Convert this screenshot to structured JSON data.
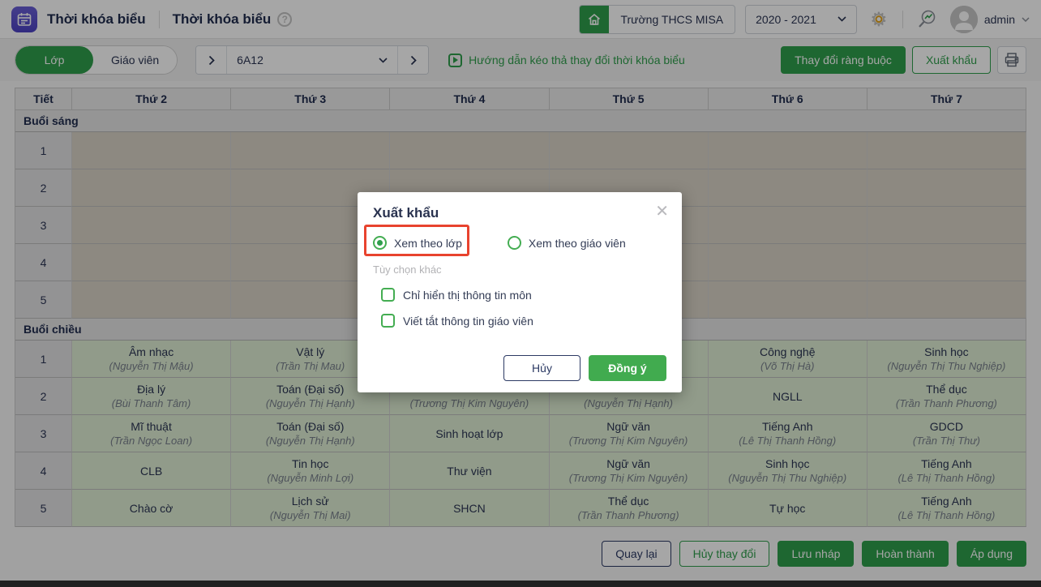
{
  "colors": {
    "brand_green": "#2f9e4c",
    "modal_green": "#41ab4f",
    "annotation_red": "#e8432e",
    "navy_text": "#2b3553",
    "app_icon_purple": "#5b53c8",
    "filled_cell": "#dfeed4",
    "empty_cell": "#d9d3c7"
  },
  "header": {
    "app_title": "Thời khóa biểu",
    "page_title": "Thời khóa biểu",
    "school_name": "Trường THCS MISA",
    "school_year": "2020 - 2021",
    "user_name": "admin"
  },
  "toolbar": {
    "tab_class": "Lớp",
    "tab_teacher": "Giáo viên",
    "selected_class": "6A12",
    "guide_link": "Hướng dẫn kéo thả thay đổi thời khóa biểu",
    "change_constraints_button": "Thay đổi ràng buộc",
    "export_button": "Xuất khẩu"
  },
  "table": {
    "headers": [
      "Tiết",
      "Thứ 2",
      "Thứ 3",
      "Thứ 4",
      "Thứ 5",
      "Thứ 6",
      "Thứ 7"
    ],
    "morning_label": "Buổi sáng",
    "afternoon_label": "Buổi chiều",
    "morning_periods": [
      "1",
      "2",
      "3",
      "4",
      "5"
    ],
    "afternoon_rows": [
      {
        "period": "1",
        "cells": [
          {
            "s": "Âm nhạc",
            "t": "(Nguyễn Thị Mậu)"
          },
          {
            "s": "Vật lý",
            "t": "(Trần Thị Mau)"
          },
          {
            "s": "",
            "t": ""
          },
          {
            "s": "",
            "t": ""
          },
          {
            "s": "Công nghệ",
            "t": "(Võ Thị Hà)"
          },
          {
            "s": "Sinh học",
            "t": "(Nguyễn Thị Thu Nghiệp)"
          }
        ]
      },
      {
        "period": "2",
        "cells": [
          {
            "s": "Địa lý",
            "t": "(Bùi Thanh Tâm)"
          },
          {
            "s": "Toán (Đại số)",
            "t": "(Nguyễn Thị Hạnh)"
          },
          {
            "s": "",
            "t": "(Trương Thị Kim Nguyên)"
          },
          {
            "s": "",
            "t": "(Nguyễn Thị Hạnh)"
          },
          {
            "s": "NGLL",
            "t": ""
          },
          {
            "s": "Thể dục",
            "t": "(Trần Thanh Phương)"
          }
        ]
      },
      {
        "period": "3",
        "cells": [
          {
            "s": "Mĩ thuật",
            "t": "(Trần Ngọc Loan)"
          },
          {
            "s": "Toán (Đại số)",
            "t": "(Nguyễn Thị Hạnh)"
          },
          {
            "s": "Sinh hoạt lớp",
            "t": ""
          },
          {
            "s": "Ngữ văn",
            "t": "(Trương Thị Kim Nguyên)"
          },
          {
            "s": "Tiếng Anh",
            "t": "(Lê Thị Thanh Hồng)"
          },
          {
            "s": "GDCD",
            "t": "(Trần Thị Thư)"
          }
        ]
      },
      {
        "period": "4",
        "cells": [
          {
            "s": "CLB",
            "t": ""
          },
          {
            "s": "Tin học",
            "t": "(Nguyễn Minh Lợi)"
          },
          {
            "s": "Thư viện",
            "t": ""
          },
          {
            "s": "Ngữ văn",
            "t": "(Trương Thị Kim Nguyên)"
          },
          {
            "s": "Sinh học",
            "t": "(Nguyễn Thị Thu Nghiệp)"
          },
          {
            "s": "Tiếng Anh",
            "t": "(Lê Thị Thanh Hồng)"
          }
        ]
      },
      {
        "period": "5",
        "cells": [
          {
            "s": "Chào cờ",
            "t": ""
          },
          {
            "s": "Lịch sử",
            "t": "(Nguyễn Thị Mai)"
          },
          {
            "s": "SHCN",
            "t": ""
          },
          {
            "s": "Thể dục",
            "t": "(Trần Thanh Phương)"
          },
          {
            "s": "Tự học",
            "t": ""
          },
          {
            "s": "Tiếng Anh",
            "t": "(Lê Thị Thanh Hồng)"
          }
        ]
      }
    ]
  },
  "modal": {
    "title": "Xuất khẩu",
    "radio_by_class": "Xem theo lớp",
    "radio_by_teacher": "Xem theo giáo viên",
    "options_label": "Tùy chọn khác",
    "checkbox_subject_only": "Chỉ hiển thị thông tin môn",
    "checkbox_abbrev_teacher": "Viết tắt thông tin giáo viên",
    "cancel_button": "Hủy",
    "ok_button": "Đồng ý"
  },
  "footer": {
    "buttons": [
      {
        "label": "Quay lại",
        "style": "navy-outline",
        "name": "back-button"
      },
      {
        "label": "Hủy thay đổi",
        "style": "green-outline",
        "name": "discard-changes-button"
      },
      {
        "label": "Lưu nháp",
        "style": "green",
        "name": "save-draft-button"
      },
      {
        "label": "Hoàn thành",
        "style": "green",
        "name": "complete-button"
      },
      {
        "label": "Áp dụng",
        "style": "green",
        "name": "apply-button"
      }
    ]
  }
}
